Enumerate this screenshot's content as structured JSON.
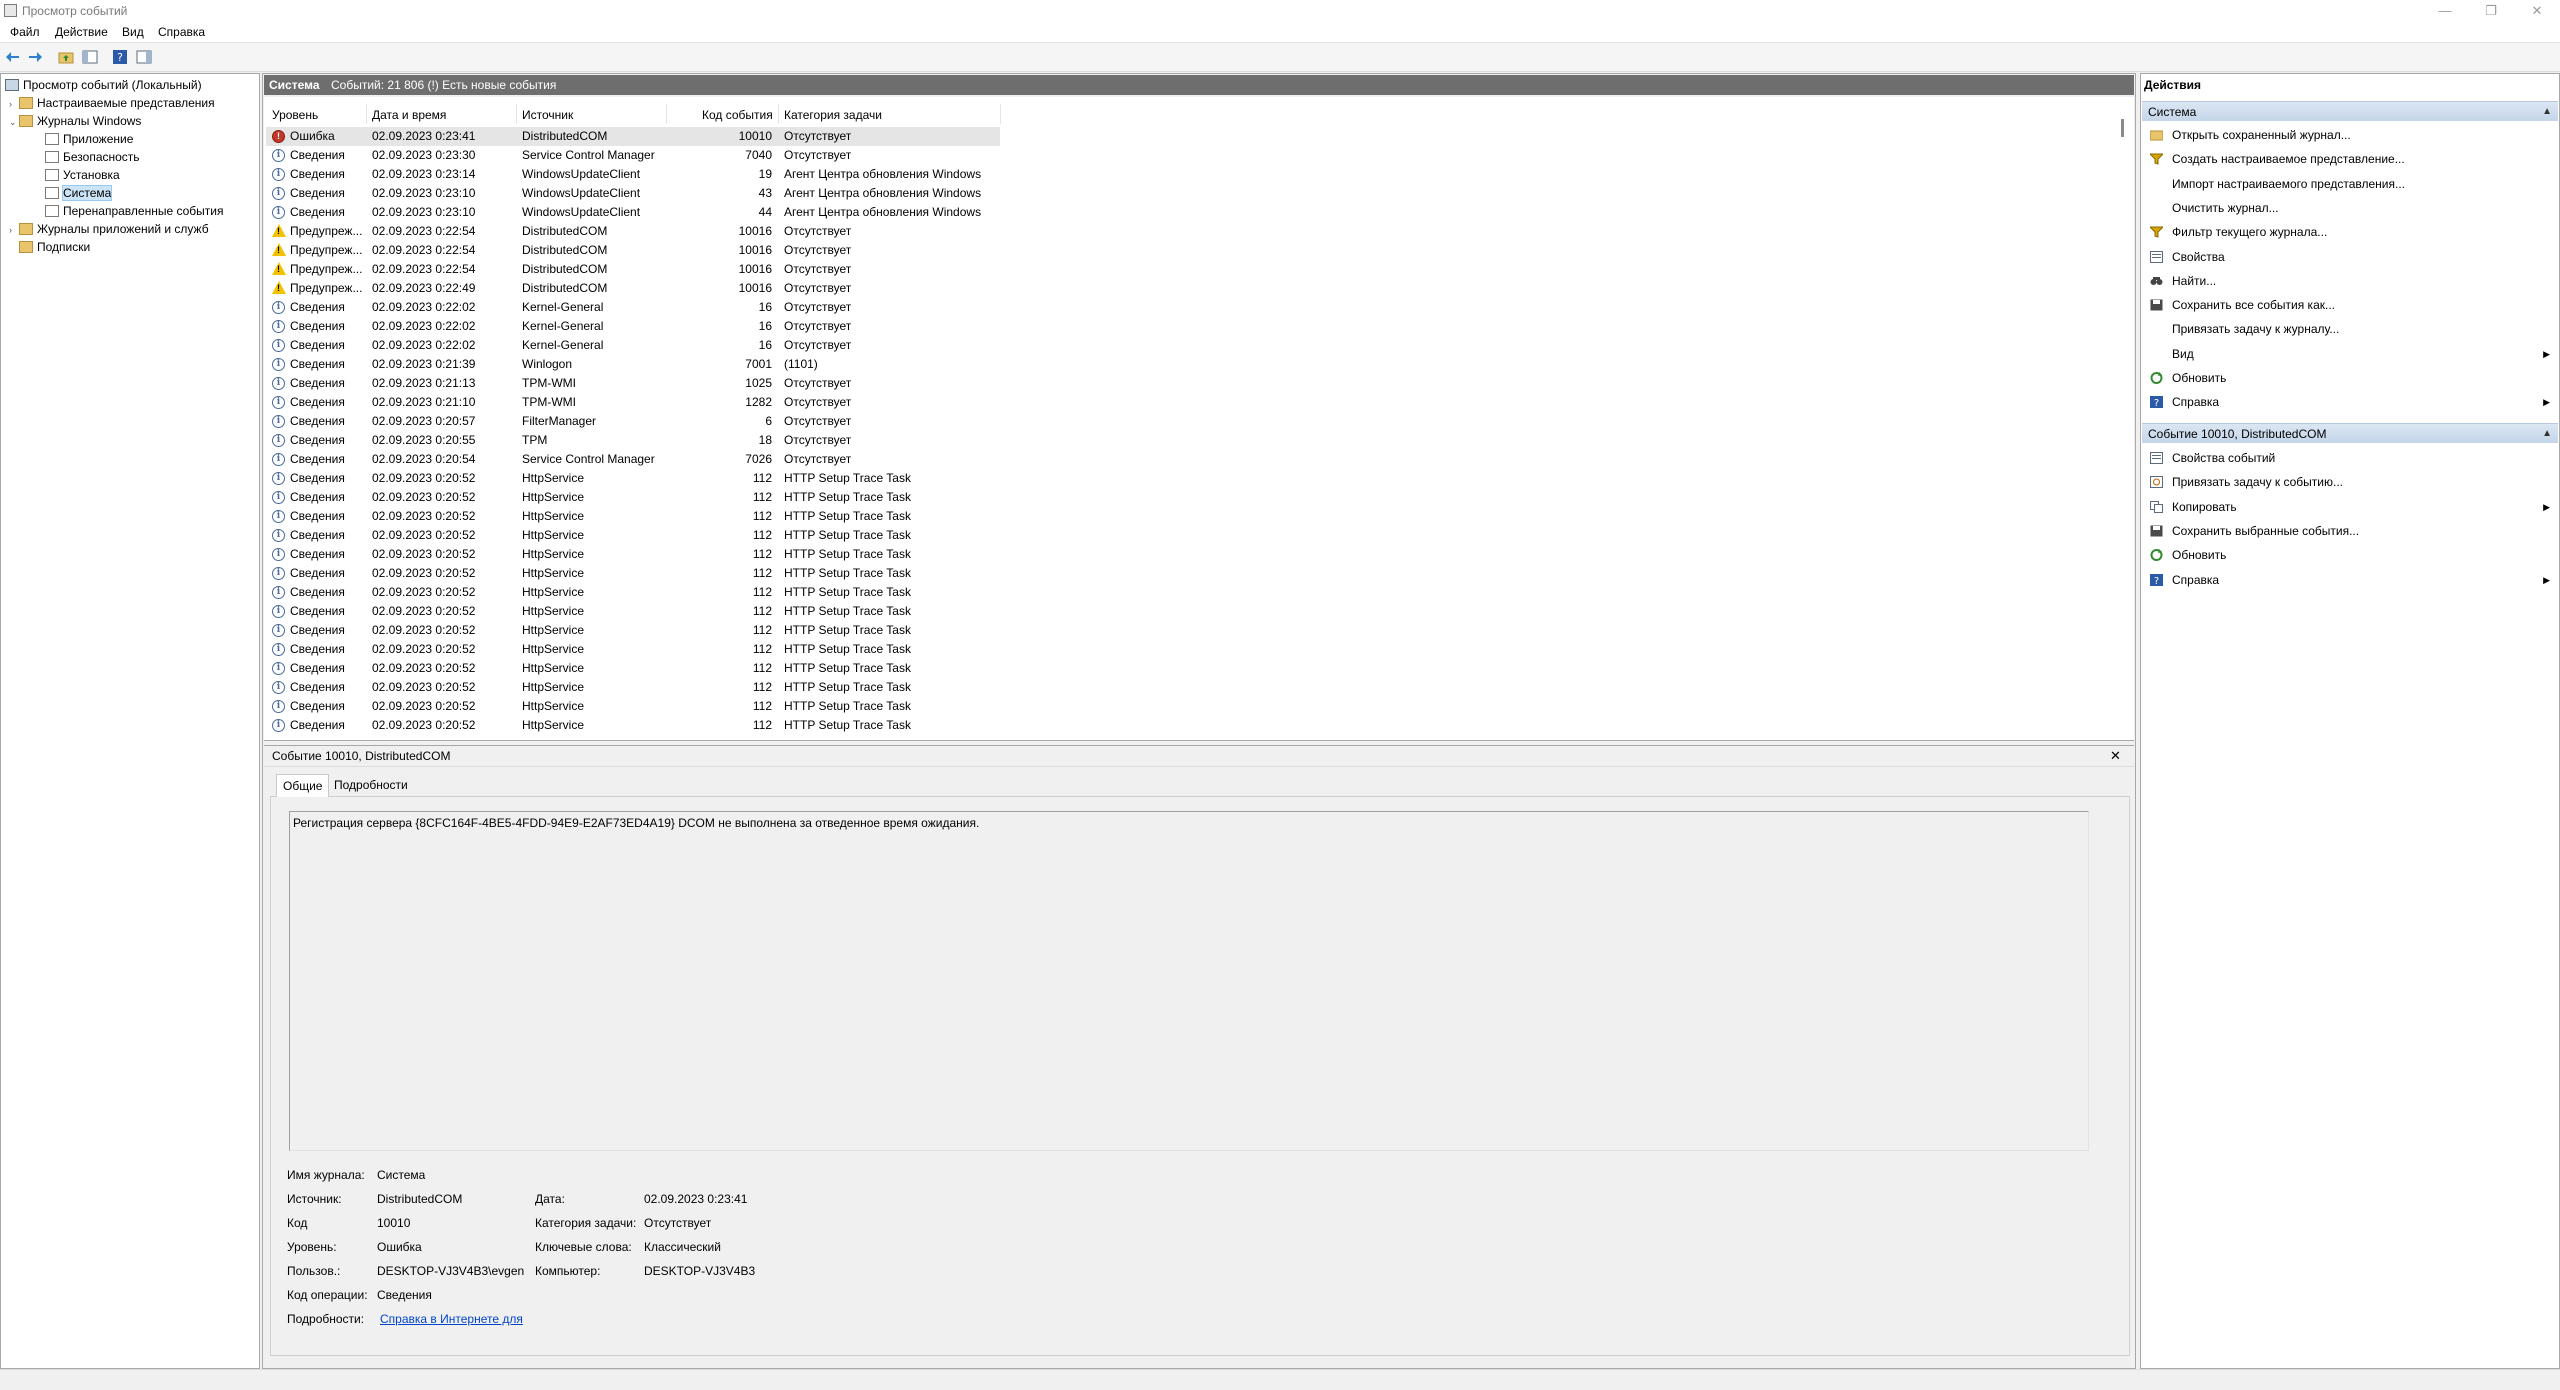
{
  "window": {
    "title": "Просмотр событий",
    "controls": {
      "minimize": "—",
      "maximize": "❐",
      "close": "✕"
    }
  },
  "menu": [
    "Файл",
    "Действие",
    "Вид",
    "Справка"
  ],
  "tree": {
    "root": "Просмотр событий (Локальный)",
    "custom_views": "Настраиваемые представления",
    "windows_logs": "Журналы Windows",
    "logs": [
      "Приложение",
      "Безопасность",
      "Установка",
      "Система",
      "Перенаправленные события"
    ],
    "app_logs": "Журналы приложений и служб",
    "subscriptions": "Подписки"
  },
  "list": {
    "header_title": "Система",
    "header_info": "Событий: 21 806 (!) Есть новые события",
    "columns": [
      "Уровень",
      "Дата и время",
      "Источник",
      "Код события",
      "Категория задачи"
    ],
    "rows": [
      {
        "level": "Ошибка",
        "type": "err",
        "date": "02.09.2023 0:23:41",
        "source": "DistributedCOM",
        "code": "10010",
        "cat": "Отсутствует"
      },
      {
        "level": "Сведения",
        "type": "info",
        "date": "02.09.2023 0:23:30",
        "source": "Service Control Manager",
        "code": "7040",
        "cat": "Отсутствует"
      },
      {
        "level": "Сведения",
        "type": "info",
        "date": "02.09.2023 0:23:14",
        "source": "WindowsUpdateClient",
        "code": "19",
        "cat": "Агент Центра обновления Windows"
      },
      {
        "level": "Сведения",
        "type": "info",
        "date": "02.09.2023 0:23:10",
        "source": "WindowsUpdateClient",
        "code": "43",
        "cat": "Агент Центра обновления Windows"
      },
      {
        "level": "Сведения",
        "type": "info",
        "date": "02.09.2023 0:23:10",
        "source": "WindowsUpdateClient",
        "code": "44",
        "cat": "Агент Центра обновления Windows"
      },
      {
        "level": "Предупреж...",
        "type": "warn",
        "date": "02.09.2023 0:22:54",
        "source": "DistributedCOM",
        "code": "10016",
        "cat": "Отсутствует"
      },
      {
        "level": "Предупреж...",
        "type": "warn",
        "date": "02.09.2023 0:22:54",
        "source": "DistributedCOM",
        "code": "10016",
        "cat": "Отсутствует"
      },
      {
        "level": "Предупреж...",
        "type": "warn",
        "date": "02.09.2023 0:22:54",
        "source": "DistributedCOM",
        "code": "10016",
        "cat": "Отсутствует"
      },
      {
        "level": "Предупреж...",
        "type": "warn",
        "date": "02.09.2023 0:22:49",
        "source": "DistributedCOM",
        "code": "10016",
        "cat": "Отсутствует"
      },
      {
        "level": "Сведения",
        "type": "info",
        "date": "02.09.2023 0:22:02",
        "source": "Kernel-General",
        "code": "16",
        "cat": "Отсутствует"
      },
      {
        "level": "Сведения",
        "type": "info",
        "date": "02.09.2023 0:22:02",
        "source": "Kernel-General",
        "code": "16",
        "cat": "Отсутствует"
      },
      {
        "level": "Сведения",
        "type": "info",
        "date": "02.09.2023 0:22:02",
        "source": "Kernel-General",
        "code": "16",
        "cat": "Отсутствует"
      },
      {
        "level": "Сведения",
        "type": "info",
        "date": "02.09.2023 0:21:39",
        "source": "Winlogon",
        "code": "7001",
        "cat": "(1101)"
      },
      {
        "level": "Сведения",
        "type": "info",
        "date": "02.09.2023 0:21:13",
        "source": "TPM-WMI",
        "code": "1025",
        "cat": "Отсутствует"
      },
      {
        "level": "Сведения",
        "type": "info",
        "date": "02.09.2023 0:21:10",
        "source": "TPM-WMI",
        "code": "1282",
        "cat": "Отсутствует"
      },
      {
        "level": "Сведения",
        "type": "info",
        "date": "02.09.2023 0:20:57",
        "source": "FilterManager",
        "code": "6",
        "cat": "Отсутствует"
      },
      {
        "level": "Сведения",
        "type": "info",
        "date": "02.09.2023 0:20:55",
        "source": "TPM",
        "code": "18",
        "cat": "Отсутствует"
      },
      {
        "level": "Сведения",
        "type": "info",
        "date": "02.09.2023 0:20:54",
        "source": "Service Control Manager",
        "code": "7026",
        "cat": "Отсутствует"
      },
      {
        "level": "Сведения",
        "type": "info",
        "date": "02.09.2023 0:20:52",
        "source": "HttpService",
        "code": "112",
        "cat": "HTTP Setup Trace Task"
      },
      {
        "level": "Сведения",
        "type": "info",
        "date": "02.09.2023 0:20:52",
        "source": "HttpService",
        "code": "112",
        "cat": "HTTP Setup Trace Task"
      },
      {
        "level": "Сведения",
        "type": "info",
        "date": "02.09.2023 0:20:52",
        "source": "HttpService",
        "code": "112",
        "cat": "HTTP Setup Trace Task"
      },
      {
        "level": "Сведения",
        "type": "info",
        "date": "02.09.2023 0:20:52",
        "source": "HttpService",
        "code": "112",
        "cat": "HTTP Setup Trace Task"
      },
      {
        "level": "Сведения",
        "type": "info",
        "date": "02.09.2023 0:20:52",
        "source": "HttpService",
        "code": "112",
        "cat": "HTTP Setup Trace Task"
      },
      {
        "level": "Сведения",
        "type": "info",
        "date": "02.09.2023 0:20:52",
        "source": "HttpService",
        "code": "112",
        "cat": "HTTP Setup Trace Task"
      },
      {
        "level": "Сведения",
        "type": "info",
        "date": "02.09.2023 0:20:52",
        "source": "HttpService",
        "code": "112",
        "cat": "HTTP Setup Trace Task"
      },
      {
        "level": "Сведения",
        "type": "info",
        "date": "02.09.2023 0:20:52",
        "source": "HttpService",
        "code": "112",
        "cat": "HTTP Setup Trace Task"
      },
      {
        "level": "Сведения",
        "type": "info",
        "date": "02.09.2023 0:20:52",
        "source": "HttpService",
        "code": "112",
        "cat": "HTTP Setup Trace Task"
      },
      {
        "level": "Сведения",
        "type": "info",
        "date": "02.09.2023 0:20:52",
        "source": "HttpService",
        "code": "112",
        "cat": "HTTP Setup Trace Task"
      },
      {
        "level": "Сведения",
        "type": "info",
        "date": "02.09.2023 0:20:52",
        "source": "HttpService",
        "code": "112",
        "cat": "HTTP Setup Trace Task"
      },
      {
        "level": "Сведения",
        "type": "info",
        "date": "02.09.2023 0:20:52",
        "source": "HttpService",
        "code": "112",
        "cat": "HTTP Setup Trace Task"
      },
      {
        "level": "Сведения",
        "type": "info",
        "date": "02.09.2023 0:20:52",
        "source": "HttpService",
        "code": "112",
        "cat": "HTTP Setup Trace Task"
      },
      {
        "level": "Сведения",
        "type": "info",
        "date": "02.09.2023 0:20:52",
        "source": "HttpService",
        "code": "112",
        "cat": "HTTP Setup Trace Task"
      }
    ]
  },
  "detail": {
    "title": "Событие 10010, DistributedCOM",
    "close": "✕",
    "tabs": [
      "Общие",
      "Подробности"
    ],
    "description": "Регистрация сервера {8CFC164F-4BE5-4FDD-94E9-E2AF73ED4A19} DCOM не выполнена за отведенное время ожидания.",
    "fields": {
      "log_name_label": "Имя журнала:",
      "log_name": "Система",
      "source_label": "Источник:",
      "source": "DistributedCOM",
      "date_label": "Дата:",
      "date": "02.09.2023 0:23:41",
      "code_label": "Код",
      "code": "10010",
      "task_cat_label": "Категория задачи:",
      "task_cat": "Отсутствует",
      "level_label": "Уровень:",
      "level": "Ошибка",
      "keywords_label": "Ключевые слова:",
      "keywords": "Классический",
      "user_label": "Пользов.:",
      "user": "DESKTOP-VJ3V4B3\\evgen",
      "computer_label": "Компьютер:",
      "computer": "DESKTOP-VJ3V4B3",
      "opcode_label": "Код операции:",
      "opcode": "Сведения",
      "more_label": "Подробности:",
      "more_link": "Справка в Интернете для"
    }
  },
  "actions": {
    "title": "Действия",
    "section1": "Система",
    "items1": [
      {
        "label": "Открыть сохраненный журнал...",
        "icon": "folder-open-icon",
        "arrow": false
      },
      {
        "label": "Создать настраиваемое представление...",
        "icon": "filter-icon",
        "arrow": false
      },
      {
        "label": "Импорт настраиваемого представления...",
        "icon": "",
        "arrow": false
      },
      {
        "label": "Очистить журнал...",
        "icon": "",
        "arrow": false
      },
      {
        "label": "Фильтр текущего журнала...",
        "icon": "filter-icon",
        "arrow": false
      },
      {
        "label": "Свойства",
        "icon": "properties-icon",
        "arrow": false
      },
      {
        "label": "Найти...",
        "icon": "binoculars-icon",
        "arrow": false
      },
      {
        "label": "Сохранить все события как...",
        "icon": "save-icon",
        "arrow": false
      },
      {
        "label": "Привязать задачу к журналу...",
        "icon": "",
        "arrow": false
      },
      {
        "label": "Вид",
        "icon": "",
        "arrow": true
      },
      {
        "label": "Обновить",
        "icon": "refresh-icon",
        "arrow": false
      },
      {
        "label": "Справка",
        "icon": "help-icon",
        "arrow": true
      }
    ],
    "section2": "Событие 10010, DistributedCOM",
    "items2": [
      {
        "label": "Свойства событий",
        "icon": "properties-icon",
        "arrow": false
      },
      {
        "label": "Привязать задачу к событию...",
        "icon": "task-icon",
        "arrow": false
      },
      {
        "label": "Копировать",
        "icon": "copy-icon",
        "arrow": true
      },
      {
        "label": "Сохранить выбранные события...",
        "icon": "save-icon",
        "arrow": false
      },
      {
        "label": "Обновить",
        "icon": "refresh-icon",
        "arrow": false
      },
      {
        "label": "Справка",
        "icon": "help-icon",
        "arrow": true
      }
    ],
    "caret": "▲",
    "arrow_glyph": "▶"
  },
  "colors": {
    "accent": "#6e6e6e",
    "section_bg": "#c5d6ea",
    "link": "#0044cc",
    "error": "#c0392b",
    "warning": "#f2c200"
  }
}
